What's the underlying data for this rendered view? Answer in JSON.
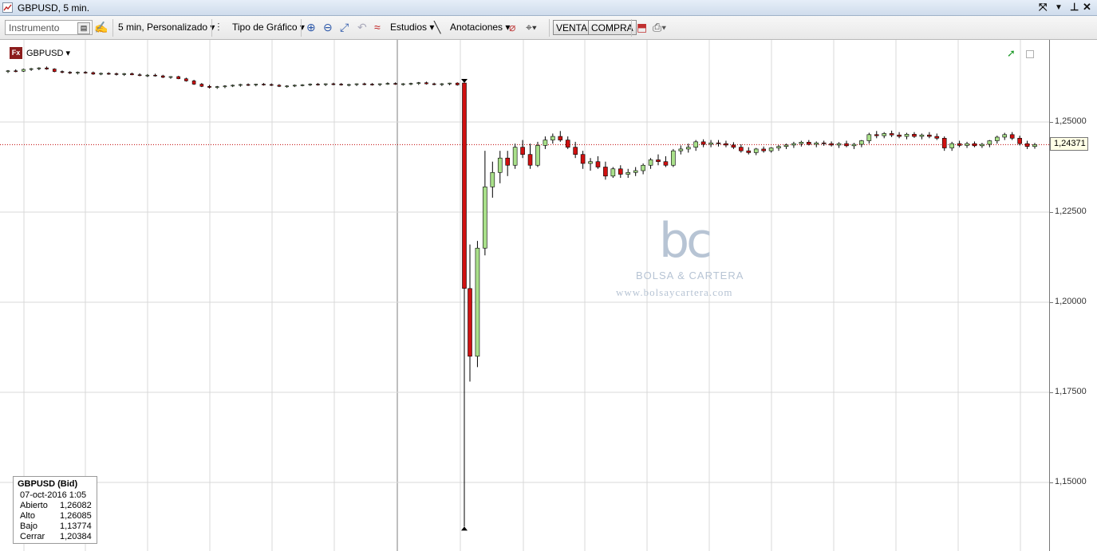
{
  "window": {
    "title": "GBPUSD, 5 min."
  },
  "toolbar": {
    "instrument_placeholder": "Instrumento",
    "timeframe": "5 min,  Personalizado",
    "chart_type": "Tipo de Gráfico",
    "studies": "Estudios",
    "annotations": "Anotaciones",
    "sell": "VENTA",
    "buy": "COMPRA"
  },
  "chart": {
    "symbol": "GBPUSD",
    "current_price_tag": "1,24371",
    "y_tick_labels": [
      "1,25000",
      "1,22500",
      "1,20000",
      "1,17500",
      "1,15000"
    ],
    "watermark": {
      "logo": "bc",
      "name": "BOLSA & CARTERA",
      "url": "www.bolsaycartera.com"
    }
  },
  "info_panel": {
    "header": "GBPUSD (Bid)",
    "datetime": "07-oct-2016 1:05",
    "rows": [
      {
        "label": "Abierto",
        "value": "1,26082"
      },
      {
        "label": "Alto",
        "value": "1,26085"
      },
      {
        "label": "Bajo",
        "value": "1,13774"
      },
      {
        "label": "Cerrar",
        "value": "1,20384"
      }
    ]
  },
  "colors": {
    "up": "#a9e08a",
    "down": "#d01010",
    "price_line": "#c00000",
    "grid": "#d8d8d8"
  },
  "chart_data": {
    "type": "candlestick",
    "ylim": [
      1.1355,
      1.268
    ],
    "yticks": [
      1.25,
      1.225,
      1.2,
      1.175,
      1.15
    ],
    "current_price": 1.24371,
    "candles": [
      [
        1.264,
        1.2644,
        1.2636,
        1.2642
      ],
      [
        1.2642,
        1.2646,
        1.2638,
        1.2641
      ],
      [
        1.2641,
        1.2648,
        1.2639,
        1.2646
      ],
      [
        1.2646,
        1.265,
        1.2642,
        1.2648
      ],
      [
        1.2648,
        1.2652,
        1.2644,
        1.265
      ],
      [
        1.265,
        1.2654,
        1.2645,
        1.2647
      ],
      [
        1.2647,
        1.2649,
        1.2638,
        1.264
      ],
      [
        1.264,
        1.2643,
        1.2635,
        1.2638
      ],
      [
        1.2638,
        1.2641,
        1.2633,
        1.2636
      ],
      [
        1.2636,
        1.264,
        1.2632,
        1.2638
      ],
      [
        1.2638,
        1.2641,
        1.2634,
        1.2637
      ],
      [
        1.2637,
        1.264,
        1.2631,
        1.2633
      ],
      [
        1.2633,
        1.2637,
        1.263,
        1.2635
      ],
      [
        1.2635,
        1.2638,
        1.2631,
        1.2634
      ],
      [
        1.2634,
        1.2637,
        1.2629,
        1.2632
      ],
      [
        1.2632,
        1.2636,
        1.2628,
        1.2634
      ],
      [
        1.2634,
        1.2637,
        1.263,
        1.2631
      ],
      [
        1.2631,
        1.2635,
        1.2627,
        1.2629
      ],
      [
        1.2629,
        1.2633,
        1.2625,
        1.263
      ],
      [
        1.263,
        1.2634,
        1.2626,
        1.2628
      ],
      [
        1.2628,
        1.2631,
        1.2622,
        1.2624
      ],
      [
        1.2624,
        1.2627,
        1.262,
        1.2626
      ],
      [
        1.2626,
        1.2628,
        1.2619,
        1.262
      ],
      [
        1.262,
        1.2623,
        1.2612,
        1.2614
      ],
      [
        1.2614,
        1.2617,
        1.2603,
        1.2605
      ],
      [
        1.2605,
        1.2608,
        1.2597,
        1.2599
      ],
      [
        1.2599,
        1.2603,
        1.2593,
        1.2596
      ],
      [
        1.2596,
        1.26,
        1.2592,
        1.2598
      ],
      [
        1.2598,
        1.2602,
        1.2594,
        1.26
      ],
      [
        1.26,
        1.2604,
        1.2597,
        1.2602
      ],
      [
        1.2602,
        1.2606,
        1.2598,
        1.2604
      ],
      [
        1.2604,
        1.2607,
        1.26,
        1.2603
      ],
      [
        1.2603,
        1.2606,
        1.2599,
        1.2605
      ],
      [
        1.2605,
        1.2608,
        1.2601,
        1.2604
      ],
      [
        1.2604,
        1.2607,
        1.26,
        1.2602
      ],
      [
        1.2602,
        1.2605,
        1.2597,
        1.2599
      ],
      [
        1.2599,
        1.2602,
        1.2595,
        1.26
      ],
      [
        1.26,
        1.2604,
        1.2597,
        1.2602
      ],
      [
        1.2602,
        1.2605,
        1.2599,
        1.2603
      ],
      [
        1.2603,
        1.2607,
        1.26,
        1.2605
      ],
      [
        1.2605,
        1.2608,
        1.2601,
        1.2604
      ],
      [
        1.2604,
        1.2607,
        1.26,
        1.2606
      ],
      [
        1.2606,
        1.2609,
        1.2602,
        1.2605
      ],
      [
        1.2605,
        1.2608,
        1.2601,
        1.2603
      ],
      [
        1.2603,
        1.2606,
        1.2599,
        1.2604
      ],
      [
        1.2604,
        1.2607,
        1.26,
        1.2606
      ],
      [
        1.2606,
        1.2609,
        1.2602,
        1.2605
      ],
      [
        1.2605,
        1.2608,
        1.2601,
        1.2604
      ],
      [
        1.2604,
        1.2607,
        1.26,
        1.2606
      ],
      [
        1.2606,
        1.261,
        1.2603,
        1.2607
      ],
      [
        1.2607,
        1.261,
        1.2603,
        1.2605
      ],
      [
        1.2605,
        1.2608,
        1.2601,
        1.2606
      ],
      [
        1.2606,
        1.2609,
        1.2602,
        1.2607
      ],
      [
        1.2607,
        1.2611,
        1.2603,
        1.2609
      ],
      [
        1.2609,
        1.2612,
        1.2604,
        1.2606
      ],
      [
        1.2606,
        1.2609,
        1.2602,
        1.2604
      ],
      [
        1.2604,
        1.2608,
        1.26,
        1.2606
      ],
      [
        1.2606,
        1.2609,
        1.2602,
        1.2608
      ],
      [
        1.2608,
        1.261,
        1.2601,
        1.2603
      ],
      [
        1.26082,
        1.26085,
        1.13774,
        1.20384
      ],
      [
        1.2038,
        1.216,
        1.178,
        1.185
      ],
      [
        1.185,
        1.217,
        1.182,
        1.215
      ],
      [
        1.215,
        1.242,
        1.213,
        1.232
      ],
      [
        1.232,
        1.239,
        1.229,
        1.236
      ],
      [
        1.236,
        1.242,
        1.233,
        1.24
      ],
      [
        1.24,
        1.242,
        1.235,
        1.238
      ],
      [
        1.238,
        1.244,
        1.237,
        1.243
      ],
      [
        1.243,
        1.245,
        1.24,
        1.241
      ],
      [
        1.241,
        1.244,
        1.237,
        1.238
      ],
      [
        1.238,
        1.2445,
        1.2375,
        1.2435
      ],
      [
        1.2435,
        1.246,
        1.2425,
        1.245
      ],
      [
        1.245,
        1.2468,
        1.244,
        1.246
      ],
      [
        1.246,
        1.2475,
        1.2445,
        1.245
      ],
      [
        1.245,
        1.246,
        1.2425,
        1.243
      ],
      [
        1.243,
        1.2445,
        1.24,
        1.241
      ],
      [
        1.241,
        1.242,
        1.237,
        1.2385
      ],
      [
        1.2385,
        1.24,
        1.2365,
        1.239
      ],
      [
        1.239,
        1.2405,
        1.237,
        1.2375
      ],
      [
        1.2375,
        1.239,
        1.234,
        1.235
      ],
      [
        1.235,
        1.2375,
        1.2345,
        1.237
      ],
      [
        1.237,
        1.238,
        1.2345,
        1.2355
      ],
      [
        1.2355,
        1.237,
        1.2345,
        1.236
      ],
      [
        1.236,
        1.2375,
        1.235,
        1.2365
      ],
      [
        1.2365,
        1.2385,
        1.2355,
        1.238
      ],
      [
        1.238,
        1.24,
        1.237,
        1.2395
      ],
      [
        1.2395,
        1.241,
        1.238,
        1.239
      ],
      [
        1.239,
        1.2405,
        1.2375,
        1.238
      ],
      [
        1.238,
        1.2425,
        1.2375,
        1.242
      ],
      [
        1.242,
        1.2435,
        1.241,
        1.2425
      ],
      [
        1.2425,
        1.244,
        1.2415,
        1.243
      ],
      [
        1.243,
        1.245,
        1.242,
        1.2445
      ],
      [
        1.2445,
        1.2452,
        1.243,
        1.2438
      ],
      [
        1.2438,
        1.245,
        1.243,
        1.2442
      ],
      [
        1.2442,
        1.245,
        1.2432,
        1.244
      ],
      [
        1.244,
        1.2448,
        1.243,
        1.2436
      ],
      [
        1.2436,
        1.2444,
        1.2425,
        1.243
      ],
      [
        1.243,
        1.2438,
        1.2415,
        1.242
      ],
      [
        1.242,
        1.243,
        1.241,
        1.2415
      ],
      [
        1.2415,
        1.2428,
        1.2408,
        1.2425
      ],
      [
        1.2425,
        1.2432,
        1.2415,
        1.242
      ],
      [
        1.242,
        1.243,
        1.2415,
        1.2428
      ],
      [
        1.2428,
        1.2436,
        1.242,
        1.2432
      ],
      [
        1.2432,
        1.244,
        1.2425,
        1.2436
      ],
      [
        1.2436,
        1.2445,
        1.2428,
        1.244
      ],
      [
        1.244,
        1.2448,
        1.2432,
        1.2444
      ],
      [
        1.2444,
        1.245,
        1.2435,
        1.2438
      ],
      [
        1.2438,
        1.2446,
        1.243,
        1.2442
      ],
      [
        1.2442,
        1.2448,
        1.2434,
        1.244
      ],
      [
        1.244,
        1.2446,
        1.2432,
        1.2436
      ],
      [
        1.2436,
        1.2444,
        1.2428,
        1.244
      ],
      [
        1.244,
        1.2448,
        1.243,
        1.2434
      ],
      [
        1.2434,
        1.2442,
        1.2425,
        1.2438
      ],
      [
        1.2438,
        1.245,
        1.243,
        1.2448
      ],
      [
        1.2448,
        1.247,
        1.244,
        1.2465
      ],
      [
        1.2465,
        1.2475,
        1.2455,
        1.2462
      ],
      [
        1.2462,
        1.2472,
        1.2455,
        1.2468
      ],
      [
        1.2468,
        1.2476,
        1.2458,
        1.2464
      ],
      [
        1.2464,
        1.2472,
        1.2455,
        1.246
      ],
      [
        1.246,
        1.247,
        1.2452,
        1.2466
      ],
      [
        1.2466,
        1.2472,
        1.2456,
        1.246
      ],
      [
        1.246,
        1.2468,
        1.2452,
        1.2464
      ],
      [
        1.2464,
        1.2472,
        1.2455,
        1.246
      ],
      [
        1.246,
        1.2468,
        1.245,
        1.2455
      ],
      [
        1.2455,
        1.246,
        1.242,
        1.2428
      ],
      [
        1.2428,
        1.2445,
        1.242,
        1.244
      ],
      [
        1.244,
        1.2448,
        1.243,
        1.2435
      ],
      [
        1.2435,
        1.2445,
        1.2428,
        1.244
      ],
      [
        1.244,
        1.2446,
        1.243,
        1.2434
      ],
      [
        1.2434,
        1.2442,
        1.2428,
        1.2438
      ],
      [
        1.2438,
        1.245,
        1.243,
        1.2448
      ],
      [
        1.2448,
        1.2462,
        1.244,
        1.2458
      ],
      [
        1.2458,
        1.247,
        1.245,
        1.2465
      ],
      [
        1.2465,
        1.2472,
        1.245,
        1.2455
      ],
      [
        1.2455,
        1.2462,
        1.2435,
        1.244
      ],
      [
        1.244,
        1.2448,
        1.2425,
        1.2432
      ],
      [
        1.2432,
        1.2442,
        1.2426,
        1.24371
      ]
    ]
  }
}
